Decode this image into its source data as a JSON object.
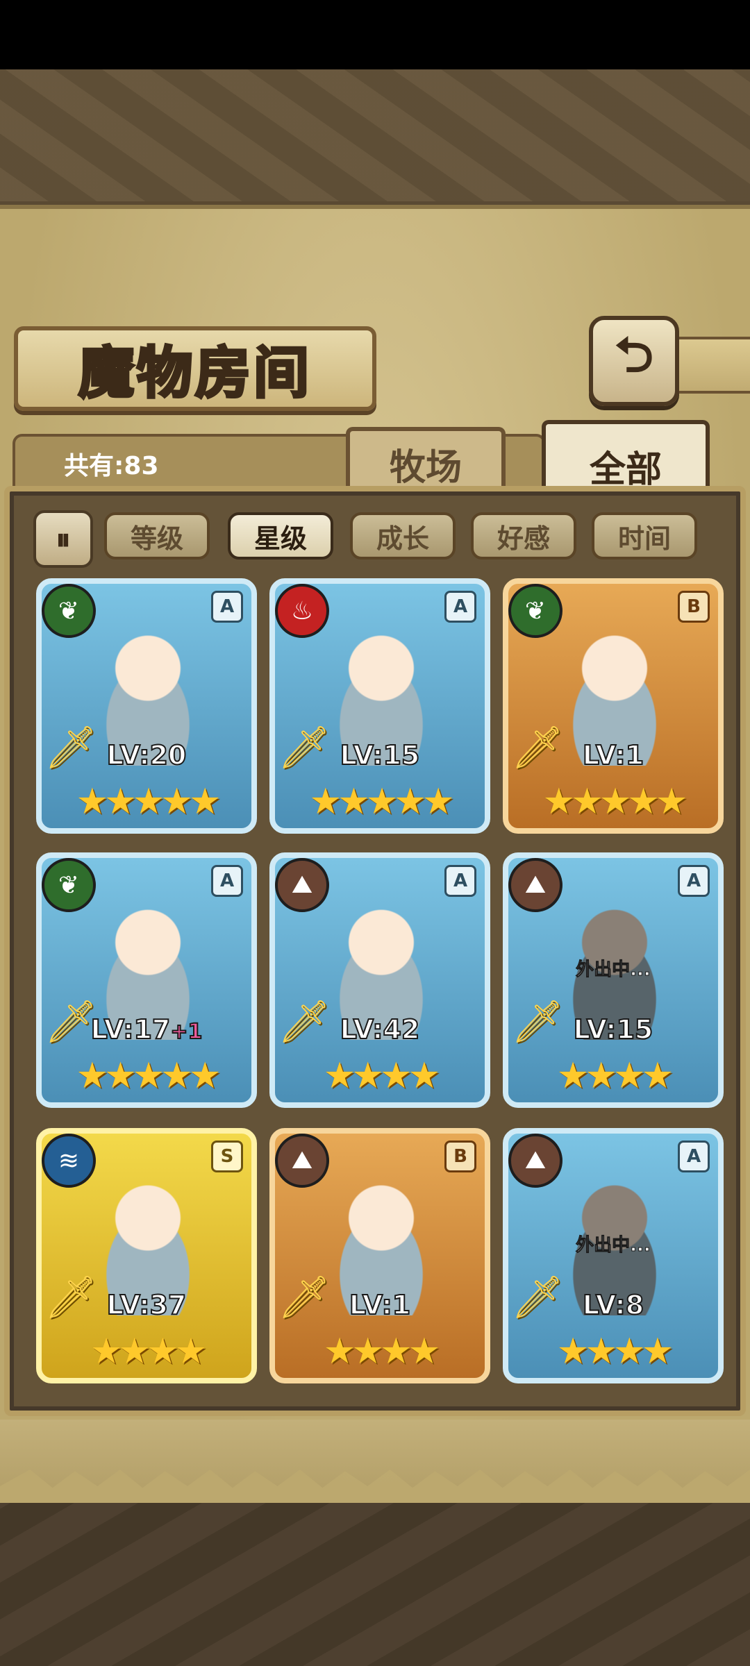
{
  "title": "魔物房间",
  "back_icon": "return-arrow-icon",
  "count_label": "共有:83",
  "tabs": [
    {
      "label": "牧场",
      "active": false
    },
    {
      "label": "全部",
      "active": true
    }
  ],
  "sort_toggle_icon": "sort-order-icon",
  "sort_buttons": [
    {
      "label": "等级",
      "active": false
    },
    {
      "label": "星级",
      "active": true
    },
    {
      "label": "成长",
      "active": false
    },
    {
      "label": "好感",
      "active": false
    },
    {
      "label": "时间",
      "active": false
    }
  ],
  "monsters": [
    {
      "level": "LV:20",
      "plus": "",
      "stars": "★★★★★",
      "star_count": 5,
      "rank": "A",
      "element": "nature",
      "frame": "blue",
      "status": ""
    },
    {
      "level": "LV:15",
      "plus": "",
      "stars": "★★★★★",
      "star_count": 5,
      "rank": "A",
      "element": "fire",
      "frame": "blue",
      "status": ""
    },
    {
      "level": "LV:1",
      "plus": "",
      "stars": "★★★★★",
      "star_count": 5,
      "rank": "B",
      "element": "nature",
      "frame": "orange",
      "status": ""
    },
    {
      "level": "LV:17",
      "plus": "+1",
      "stars": "★★★★★",
      "star_count": 5,
      "rank": "A",
      "element": "nature",
      "frame": "blue",
      "status": ""
    },
    {
      "level": "LV:42",
      "plus": "",
      "stars": "★★★★",
      "star_count": 4,
      "rank": "A",
      "element": "earth",
      "frame": "blue",
      "status": ""
    },
    {
      "level": "LV:15",
      "plus": "",
      "stars": "★★★★",
      "star_count": 4,
      "rank": "A",
      "element": "earth",
      "frame": "blue",
      "status": "外出中..."
    },
    {
      "level": "LV:37",
      "plus": "",
      "stars": "★★★★",
      "star_count": 4,
      "rank": "S",
      "element": "water",
      "frame": "yellow",
      "status": ""
    },
    {
      "level": "LV:1",
      "plus": "",
      "stars": "★★★★",
      "star_count": 4,
      "rank": "B",
      "element": "earth",
      "frame": "orange",
      "status": ""
    },
    {
      "level": "LV:8",
      "plus": "",
      "stars": "★★★★",
      "star_count": 4,
      "rank": "A",
      "element": "earth",
      "frame": "blue",
      "status": "外出中..."
    }
  ],
  "element_icons": {
    "nature": "leaf-icon",
    "fire": "flame-icon",
    "earth": "rock-icon",
    "water": "water-wave-icon"
  }
}
